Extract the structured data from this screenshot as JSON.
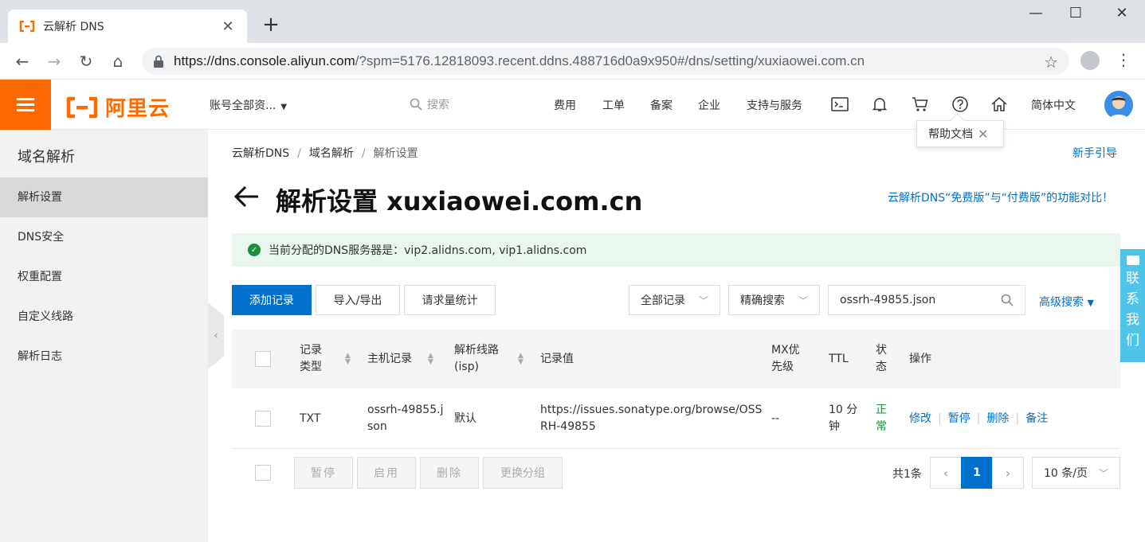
{
  "browser": {
    "tab_title": "云解析 DNS",
    "url_host": "https://dns.console.aliyun.com",
    "url_rest": "/?spm=5176.12818093.recent.ddns.488716d0a9x950#/dns/setting/xuxiaowei.com.cn"
  },
  "header": {
    "logo_text": "阿里云",
    "account": "账号全部资...",
    "search_placeholder": "搜索",
    "nav": [
      "费用",
      "工单",
      "备案",
      "企业",
      "支持与服务"
    ],
    "lang": "简体中文",
    "tooltip": "帮助文档"
  },
  "sidebar": {
    "title": "域名解析",
    "items": [
      "解析设置",
      "DNS安全",
      "权重配置",
      "自定义线路",
      "解析日志"
    ]
  },
  "breadcrumb": [
    "云解析DNS",
    "域名解析",
    "解析设置"
  ],
  "guide_link": "新手引导",
  "page_title": "解析设置 xuxiaowei.com.cn",
  "compare_link": "云解析DNS“免费版”与“付费版”的功能对比！",
  "alert": "当前分配的DNS服务器是：vip2.alidns.com, vip1.alidns.com",
  "toolbar": {
    "add": "添加记录",
    "import_export": "导入/导出",
    "stats": "请求量统计",
    "filter_all": "全部记录",
    "filter_exact": "精确搜索",
    "search_value": "ossrh-49855.json",
    "advanced": "高级搜索"
  },
  "table": {
    "headers": {
      "type": "记录\n类型",
      "host": "主机记录",
      "line": "解析线路\n(isp)",
      "value": "记录值",
      "mx": "MX优\n先级",
      "ttl": "TTL",
      "status": "状\n态",
      "ops": "操作"
    },
    "rows": [
      {
        "type": "TXT",
        "host": "ossrh-49855.j\nson",
        "line": "默认",
        "value": "https://issues.sonatype.org/browse/OSS\nRH-49855",
        "mx": "--",
        "ttl": "10 分\n钟",
        "status": "正\n常",
        "ops": [
          "修改",
          "暂停",
          "删除",
          "备注"
        ]
      }
    ]
  },
  "footer": {
    "pause": "暂停",
    "enable": "启用",
    "delete": "删除",
    "change_group": "更换分组",
    "total": "共1条",
    "current_page": "1",
    "page_size": "10 条/页"
  },
  "contact": "联系我们",
  "colors": {
    "brand": "#ff6a00",
    "primary": "#0070cc",
    "success": "#1e8e3e"
  }
}
